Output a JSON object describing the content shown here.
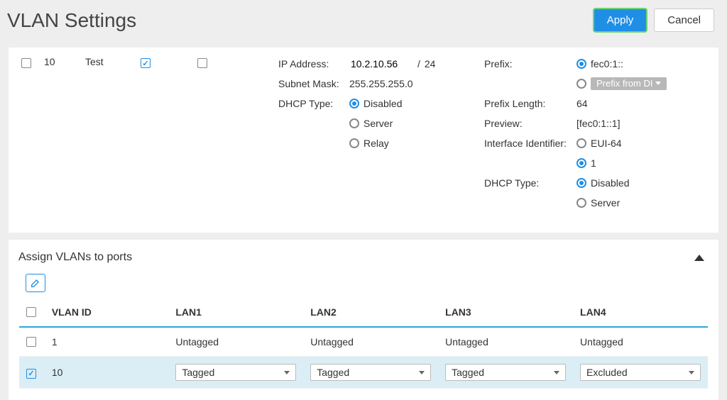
{
  "header": {
    "title": "VLAN Settings",
    "apply": "Apply",
    "cancel": "Cancel"
  },
  "vlan_row": {
    "id": "10",
    "name": "Test",
    "checkbox_row": false,
    "checkbox_enable": true,
    "checkbox_ipv6": false,
    "ip": {
      "ip_addr_label": "IP Address:",
      "ip_addr_value": "10.2.10.56",
      "ip_mask_sep": "/",
      "ip_mask_value": "24",
      "subnet_label": "Subnet Mask:",
      "subnet_value": "255.255.255.0",
      "dhcp_label": "DHCP Type:",
      "dhcp_disabled": "Disabled",
      "dhcp_server": "Server",
      "dhcp_relay": "Relay"
    },
    "ipv6": {
      "prefix_label": "Prefix:",
      "prefix_value": "fec0:1::",
      "prefix_from_dhcp": "Prefix from DI",
      "prefix_len_label": "Prefix Length:",
      "prefix_len_value": "64",
      "preview_label": "Preview:",
      "preview_value": "[fec0:1::1]",
      "iid_label": "Interface Identifier:",
      "iid_eui64": "EUI-64",
      "iid_manual": "1",
      "dhcp_label": "DHCP Type:",
      "dhcp_disabled": "Disabled",
      "dhcp_server": "Server"
    }
  },
  "ports_section": {
    "title": "Assign VLANs to ports",
    "columns": {
      "vlan_id": "VLAN ID",
      "lan1": "LAN1",
      "lan2": "LAN2",
      "lan3": "LAN3",
      "lan4": "LAN4"
    },
    "rows": [
      {
        "checked": false,
        "id": "1",
        "lan1": "Untagged",
        "lan2": "Untagged",
        "lan3": "Untagged",
        "lan4": "Untagged",
        "editable": false
      },
      {
        "checked": true,
        "id": "10",
        "lan1": "Tagged",
        "lan2": "Tagged",
        "lan3": "Tagged",
        "lan4": "Excluded",
        "editable": true
      }
    ]
  }
}
